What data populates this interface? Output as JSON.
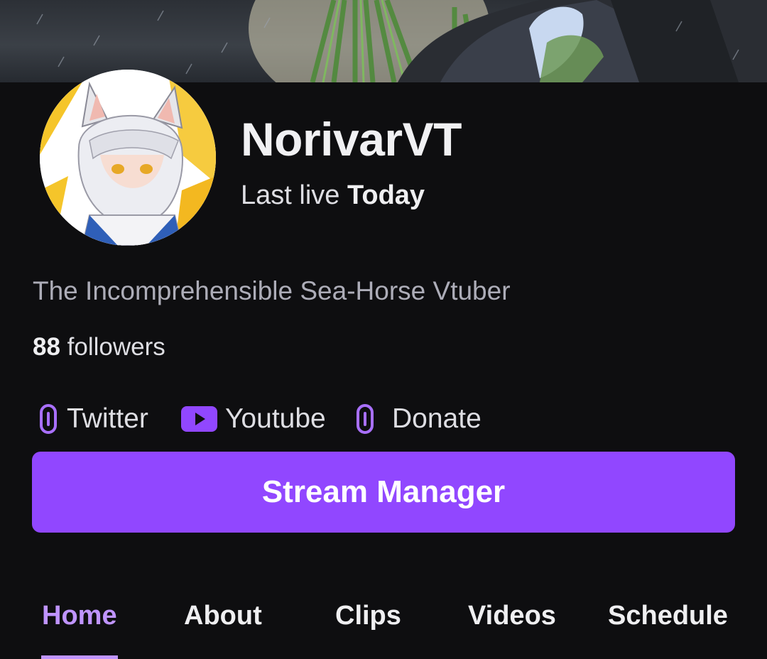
{
  "channel": {
    "name": "NorivarVT",
    "last_live_prefix": "Last live",
    "last_live_value": "Today",
    "bio": "The Incomprehensible Sea-Horse Vtuber",
    "followers_count": "88",
    "followers_label": "followers"
  },
  "links": [
    {
      "label": "Twitter",
      "icon": "link-icon"
    },
    {
      "label": "Youtube",
      "icon": "youtube-icon"
    },
    {
      "label": "Donate",
      "icon": "link-icon"
    }
  ],
  "actions": {
    "stream_manager_label": "Stream Manager"
  },
  "tabs": [
    {
      "label": "Home",
      "active": true
    },
    {
      "label": "About",
      "active": false
    },
    {
      "label": "Clips",
      "active": false
    },
    {
      "label": "Videos",
      "active": false
    },
    {
      "label": "Schedule",
      "active": false
    }
  ],
  "colors": {
    "background": "#0e0e10",
    "accent": "#9147ff",
    "active_tab": "#bf94ff",
    "text_muted": "#adadb8"
  }
}
